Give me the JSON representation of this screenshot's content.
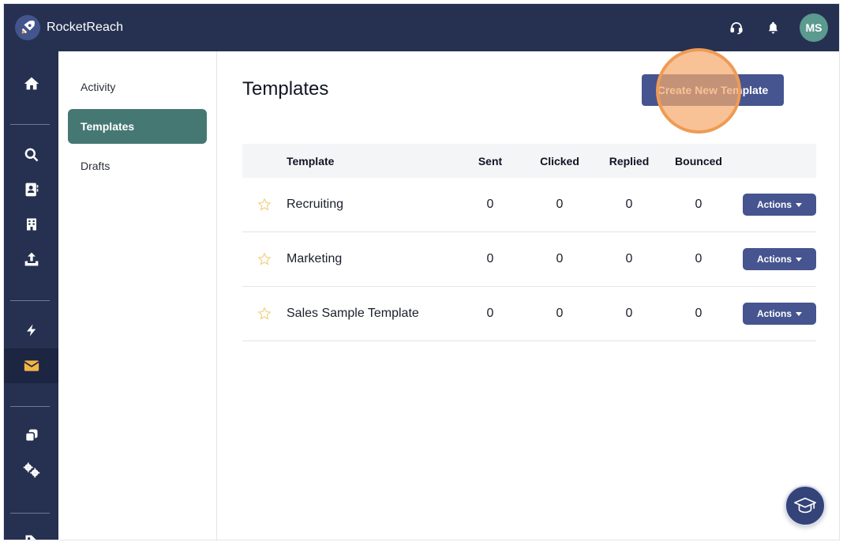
{
  "app": {
    "name": "RocketReach"
  },
  "user": {
    "initials": "MS"
  },
  "colors": {
    "topbar": "#263151",
    "accent_button": "#46548f",
    "active_nav": "#457873",
    "highlight": "#ee9b55",
    "avatar": "#5b9a8f"
  },
  "rail": {
    "items": [
      {
        "icon": "home-icon"
      },
      {
        "icon": "search-icon"
      },
      {
        "icon": "contact-card-icon"
      },
      {
        "icon": "building-icon"
      },
      {
        "icon": "upload-icon"
      },
      {
        "icon": "lightning-icon"
      },
      {
        "icon": "envelope-icon",
        "active": true
      },
      {
        "icon": "copy-icon"
      },
      {
        "icon": "gears-icon"
      },
      {
        "icon": "tag-icon"
      }
    ]
  },
  "subnav": {
    "items": [
      {
        "label": "Activity"
      },
      {
        "label": "Templates",
        "active": true
      },
      {
        "label": "Drafts"
      }
    ]
  },
  "main": {
    "title": "Templates",
    "create_button": "Create New Template",
    "table": {
      "headers": {
        "template": "Template",
        "sent": "Sent",
        "clicked": "Clicked",
        "replied": "Replied",
        "bounced": "Bounced"
      },
      "rows": [
        {
          "name": "Recruiting",
          "sent": "0",
          "clicked": "0",
          "replied": "0",
          "bounced": "0",
          "action": "Actions"
        },
        {
          "name": "Marketing",
          "sent": "0",
          "clicked": "0",
          "replied": "0",
          "bounced": "0",
          "action": "Actions"
        },
        {
          "name": "Sales Sample Template",
          "sent": "0",
          "clicked": "0",
          "replied": "0",
          "bounced": "0",
          "action": "Actions"
        }
      ]
    }
  }
}
